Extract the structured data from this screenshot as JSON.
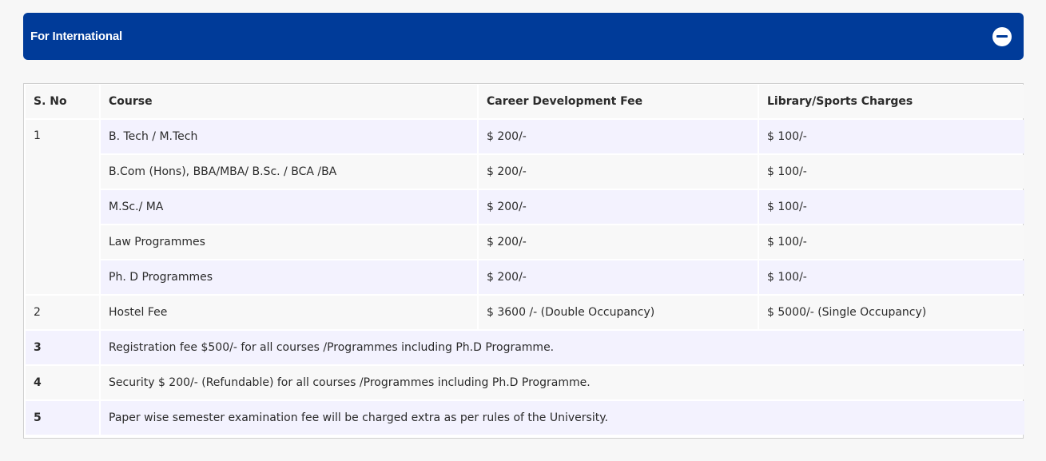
{
  "accordion": {
    "title": "For International",
    "toggle_icon": "minus-circle-icon"
  },
  "table": {
    "headers": [
      "S. No",
      "Course",
      "Career Development Fee",
      "Library/Sports Charges"
    ],
    "group1": {
      "sno": "1",
      "rows": [
        {
          "course": "B. Tech / M.Tech",
          "career_fee": "$ 200/-",
          "library": "$ 100/-"
        },
        {
          "course": "B.Com (Hons), BBA/MBA/ B.Sc. / BCA /BA",
          "career_fee": "$ 200/-",
          "library": "$ 100/-"
        },
        {
          "course": "M.Sc./ MA",
          "career_fee": "$ 200/-",
          "library": "$ 100/-"
        },
        {
          "course": "Law Programmes",
          "career_fee": "$ 200/-",
          "library": "$ 100/-"
        },
        {
          "course": "Ph. D Programmes",
          "career_fee": "$ 200/-",
          "library": "$ 100/-"
        }
      ]
    },
    "row2": {
      "sno": "2",
      "course": "Hostel Fee",
      "career_fee": "$ 3600 /- (Double Occupancy)",
      "library": "$ 5000/- (Single Occupancy)"
    },
    "notes": [
      {
        "sno": "3",
        "text": "Registration fee $500/- for all courses /Programmes including Ph.D Programme."
      },
      {
        "sno": "4",
        "text": "Security $ 200/- (Refundable) for all courses /Programmes including Ph.D Programme."
      },
      {
        "sno": "5",
        "text": "Paper wise semester examination fee will be charged extra as per rules of the University."
      }
    ]
  },
  "colors": {
    "header_bg": "#003b99",
    "row_alt": "#f3f2fe",
    "row_plain": "#f8f8f8"
  }
}
